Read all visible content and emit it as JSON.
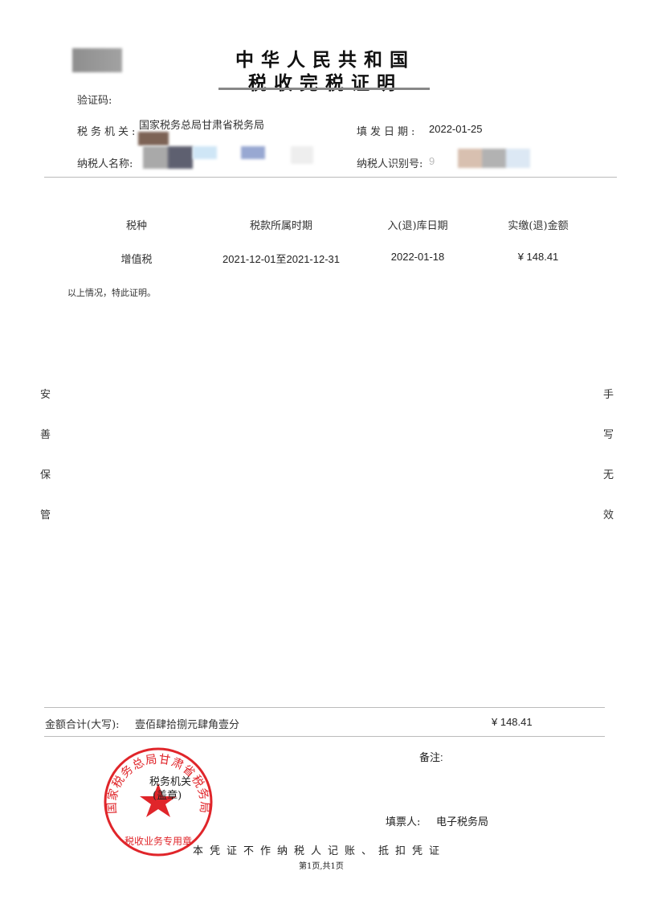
{
  "header": {
    "title_line1": "中华人民共和国",
    "title_line2": "税收完税证明"
  },
  "info": {
    "verify_code_label": "验证码:",
    "tax_office_label": "税务机关:",
    "tax_office_value": "国家税务总局甘肃省税务局",
    "issue_date_label": "填发日期:",
    "issue_date_value": "2022-01-25",
    "taxpayer_name_label": "纳税人名称:",
    "taxpayer_id_label": "纳税人识别号:",
    "taxpayer_id_partial": "9"
  },
  "table": {
    "headers": [
      "税种",
      "税款所属时期",
      "入(退)库日期",
      "实缴(退)金额"
    ],
    "rows": [
      [
        "增值税",
        "2021-12-01至2021-12-31",
        "2022-01-18",
        "¥ 148.41"
      ]
    ]
  },
  "statement": "以上情况，特此证明。",
  "side_left": [
    "安",
    "善",
    "保",
    "管"
  ],
  "side_right": [
    "手",
    "写",
    "无",
    "效"
  ],
  "total": {
    "label": "金额合计(大写):",
    "amount_words": "壹佰肆拾捌元肆角壹分",
    "amount": "¥ 148.41"
  },
  "remark_label": "备注:",
  "stamp": {
    "ring_text": "国家税务总局甘肃省税务局",
    "line1": "税务机关",
    "line2": "(盖章)",
    "bottom_text": "税收业务专用章",
    "color": "#e0252a"
  },
  "filler": {
    "label": "填票人:",
    "value": "电子税务局"
  },
  "footer_notice": "本凭证不作纳税人记账、抵扣凭证",
  "page_info": "第1页,共1页"
}
